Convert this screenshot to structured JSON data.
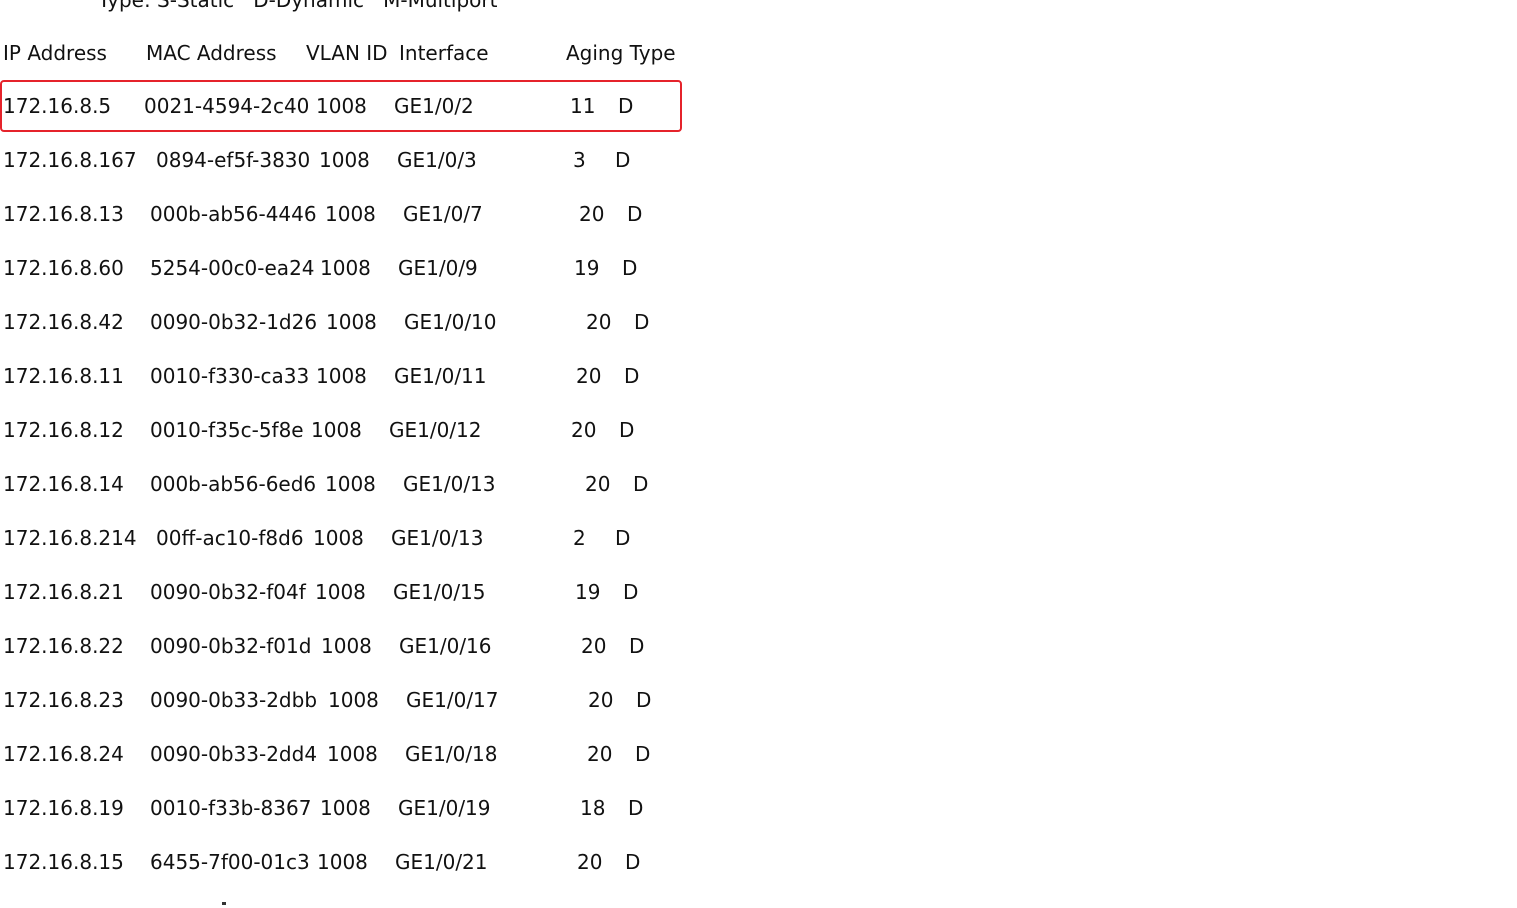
{
  "legend_line": "Type: S-Static   D-Dynamic   M-Multiport",
  "header": {
    "ip": "IP Address",
    "mac": "MAC Address",
    "vlan": "VLAN ID",
    "iface": "Interface",
    "aging_type": "Aging Type"
  },
  "rows": [
    {
      "ip": "172.16.8.5",
      "mac": "0021-4594-2c40",
      "vlan": "1008",
      "iface": "GE1/0/2",
      "aging": "11",
      "type": "D"
    },
    {
      "ip": "172.16.8.167",
      "mac": "0894-ef5f-3830",
      "vlan": "1008",
      "iface": "GE1/0/3",
      "aging": "3",
      "type": "D"
    },
    {
      "ip": "172.16.8.13",
      "mac": "000b-ab56-4446",
      "vlan": "1008",
      "iface": "GE1/0/7",
      "aging": "20",
      "type": "D"
    },
    {
      "ip": "172.16.8.60",
      "mac": "5254-00c0-ea24",
      "vlan": "1008",
      "iface": "GE1/0/9",
      "aging": "19",
      "type": "D"
    },
    {
      "ip": "172.16.8.42",
      "mac": "0090-0b32-1d26",
      "vlan": "1008",
      "iface": "GE1/0/10",
      "aging": "20",
      "type": "D"
    },
    {
      "ip": "172.16.8.11",
      "mac": "0010-f330-ca33",
      "vlan": "1008",
      "iface": "GE1/0/11",
      "aging": "20",
      "type": "D"
    },
    {
      "ip": "172.16.8.12",
      "mac": "0010-f35c-5f8e",
      "vlan": "1008",
      "iface": "GE1/0/12",
      "aging": "20",
      "type": "D"
    },
    {
      "ip": "172.16.8.14",
      "mac": "000b-ab56-6ed6",
      "vlan": "1008",
      "iface": "GE1/0/13",
      "aging": "20",
      "type": "D"
    },
    {
      "ip": "172.16.8.214",
      "mac": "00ff-ac10-f8d6",
      "vlan": "1008",
      "iface": "GE1/0/13",
      "aging": "2",
      "type": "D"
    },
    {
      "ip": "172.16.8.21",
      "mac": "0090-0b32-f04f",
      "vlan": "1008",
      "iface": "GE1/0/15",
      "aging": "19",
      "type": "D"
    },
    {
      "ip": "172.16.8.22",
      "mac": "0090-0b32-f01d",
      "vlan": "1008",
      "iface": "GE1/0/16",
      "aging": "20",
      "type": "D"
    },
    {
      "ip": "172.16.8.23",
      "mac": "0090-0b33-2dbb",
      "vlan": "1008",
      "iface": "GE1/0/17",
      "aging": "20",
      "type": "D"
    },
    {
      "ip": "172.16.8.24",
      "mac": "0090-0b33-2dd4",
      "vlan": "1008",
      "iface": "GE1/0/18",
      "aging": "20",
      "type": "D"
    },
    {
      "ip": "172.16.8.19",
      "mac": "0010-f33b-8367",
      "vlan": "1008",
      "iface": "GE1/0/19",
      "aging": "18",
      "type": "D"
    },
    {
      "ip": "172.16.8.15",
      "mac": "6455-7f00-01c3",
      "vlan": "1008",
      "iface": "GE1/0/21",
      "aging": "20",
      "type": "D"
    }
  ],
  "highlight_color": "#e5232b"
}
